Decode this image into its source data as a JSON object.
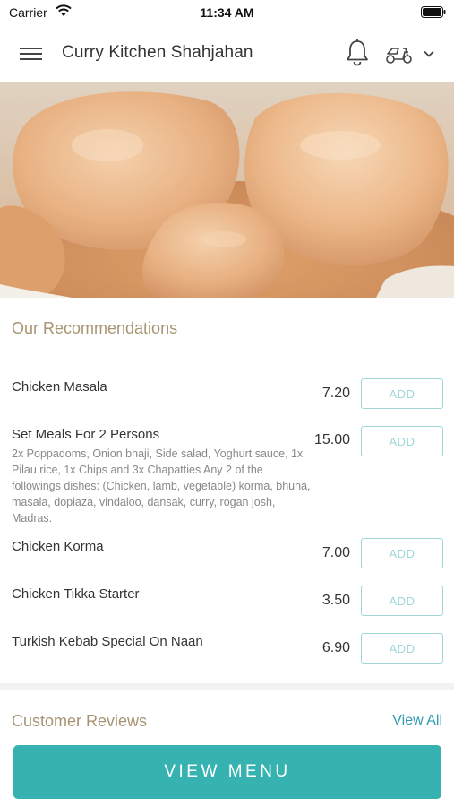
{
  "status_bar": {
    "carrier": "Carrier",
    "time": "11:34 AM"
  },
  "header": {
    "title": "Curry Kitchen Shahjahan",
    "icons": [
      "menu-icon",
      "bell-icon",
      "delivery-scooter-icon",
      "chevron-down-icon"
    ]
  },
  "recommendations": {
    "title": "Our Recommendations",
    "add_label": "ADD",
    "items": [
      {
        "name": "Chicken Masala",
        "price": "7.20",
        "description": ""
      },
      {
        "name": "Set Meals For 2 Persons",
        "price": "15.00",
        "description": "2x Poppadoms, Onion bhaji, Side salad, Yoghurt sauce, 1x Pilau rice, 1x Chips and 3x Chapatties Any 2 of the followings dishes: (Chicken, lamb, vegetable) korma, bhuna, masala, dopiaza, vindaloo, dansak, curry, rogan josh, Madras."
      },
      {
        "name": "Chicken Korma",
        "price": "7.00",
        "description": ""
      },
      {
        "name": "Chicken Tikka  Starter",
        "price": "3.50",
        "description": ""
      },
      {
        "name": "Turkish Kebab Special On Naan",
        "price": "6.90",
        "description": ""
      }
    ]
  },
  "reviews": {
    "title": "Customer Reviews",
    "view_all": "View All"
  },
  "footer": {
    "view_menu": "VIEW MENU"
  },
  "colors": {
    "accent": "#36b3b0",
    "section_title": "#a89472",
    "add_border": "#9fd7d9",
    "link": "#2e9bb0"
  }
}
